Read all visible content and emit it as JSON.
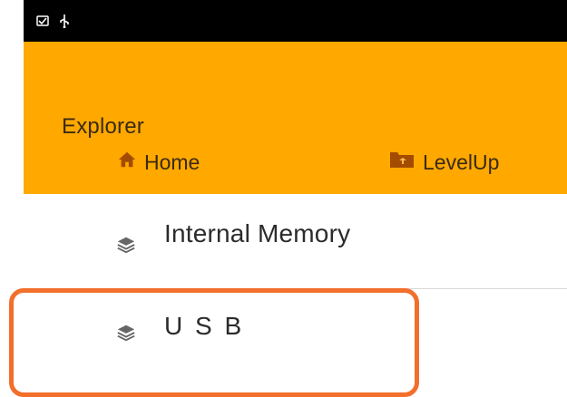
{
  "statusbar": {
    "icons": [
      "screenshot-icon",
      "usb-icon"
    ]
  },
  "header": {
    "title": "Explorer",
    "nav": [
      {
        "label": "Home",
        "icon": "home-icon"
      },
      {
        "label": "LevelUp",
        "icon": "folder-up-icon"
      }
    ]
  },
  "storage_list": [
    {
      "label": "Internal Memory",
      "icon": "layers-icon"
    },
    {
      "label": "U S B",
      "icon": "layers-icon"
    }
  ],
  "colors": {
    "header_bg": "#ffa800",
    "statusbar_bg": "#000000",
    "highlight_border": "#f26f2c"
  }
}
